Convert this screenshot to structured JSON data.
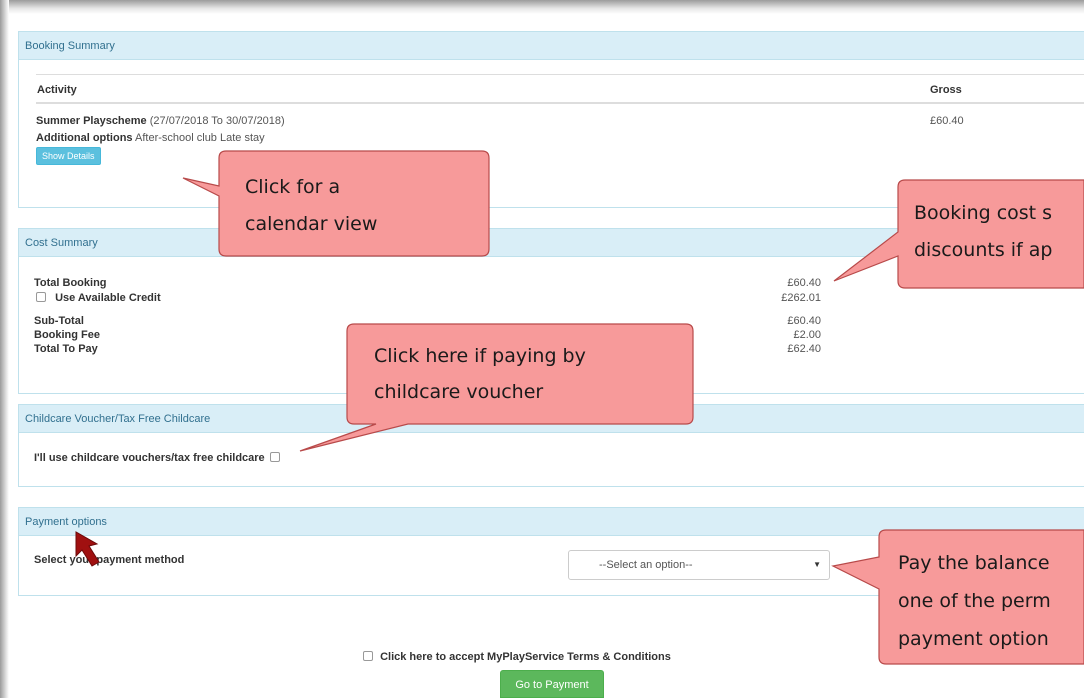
{
  "booking_summary": {
    "title": "Booking Summary",
    "columns": [
      "Activity",
      "Gross"
    ],
    "activity_name": "Summer Playscheme",
    "activity_dates": "(27/07/2018 To 30/07/2018)",
    "additional_label": "Additional options",
    "additional_value": "After-school club Late stay",
    "gross": "£60.40",
    "show_details_label": "Show Details"
  },
  "cost_summary": {
    "title": "Cost Summary",
    "rows": [
      {
        "label": "Total Booking",
        "value": "£60.40"
      },
      {
        "label": "Use Available Credit",
        "value": "£262.01",
        "checkbox": true
      },
      {
        "label": "Sub-Total",
        "value": "£60.40"
      },
      {
        "label": "Booking Fee",
        "value": "£2.00"
      },
      {
        "label": "Total To Pay",
        "value": "£62.40"
      }
    ]
  },
  "voucher": {
    "title": "Childcare Voucher/Tax Free Childcare",
    "label": "I'll use childcare vouchers/tax free childcare"
  },
  "payment_options": {
    "title": "Payment options",
    "label": "Select your payment method",
    "select_value": "--Select an option--"
  },
  "terms_label": "Click here to accept MyPlayService Terms & Conditions",
  "go_button_label": "Go to Payment",
  "callouts": {
    "calendar": [
      "Click for a",
      "calendar view"
    ],
    "cost": [
      "Booking cost s",
      "discounts if ap"
    ],
    "voucher": [
      "Click here if paying by",
      "childcare voucher"
    ],
    "balance": [
      "Pay the balance",
      "one of the perm",
      "payment option"
    ]
  },
  "colors": {
    "panel_heading_bg": "#d9eef7",
    "panel_heading_text": "#31708f",
    "info_button": "#5bc0de",
    "success_button": "#5cb85c",
    "callout_fill": "#f79a9a",
    "callout_border": "#b84a4a",
    "cursor_arrow": "#a01010"
  }
}
